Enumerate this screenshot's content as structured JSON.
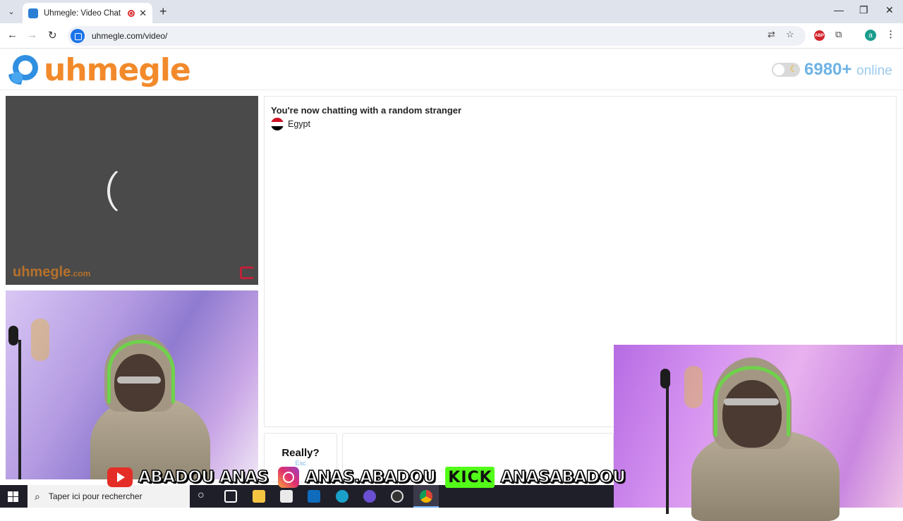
{
  "browser": {
    "tab_title": "Uhmegle: Video Chat | Ome",
    "tab_close": "✕",
    "new_tab": "+",
    "tab_menu": "⌄",
    "url": "uhmegle.com/video/",
    "back": "←",
    "forward": "→",
    "reload": "↻",
    "translate": "⇄",
    "star": "☆",
    "abp": "ABP",
    "extensions": "⧉",
    "profile_initial": "a",
    "menu": "⋮",
    "minimize": "—",
    "restore": "❐",
    "close": "✕"
  },
  "site": {
    "logo_text": "uhmegle",
    "online_count": "6980+",
    "online_label": "online",
    "moon": "☾"
  },
  "stranger_video": {
    "watermark": "uhmegle",
    "watermark_suffix": ".com"
  },
  "chat": {
    "status": "You're now chatting with a random stranger",
    "country": "Egypt",
    "stop_label": "Really?",
    "stop_hint": "Esc",
    "colors": {
      "flag_red": "#ce1126",
      "flag_white": "#ffffff",
      "flag_black": "#000000"
    }
  },
  "banner": {
    "youtube": "ABADOU ANAS",
    "instagram": "ANAS.ABADOU",
    "kick_logo": "KICK",
    "kick": "ANASABADOU"
  },
  "taskbar": {
    "search_placeholder": "Taper ici pour rechercher",
    "search_icon": "⌕",
    "cortana": "○"
  }
}
